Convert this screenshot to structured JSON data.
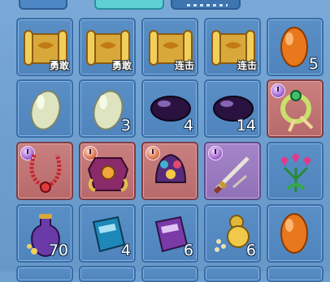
{
  "inventory": {
    "slots": [
      {
        "item": "scroll-icon",
        "tag": "勇敢",
        "count": ""
      },
      {
        "item": "scroll-icon",
        "tag": "勇敢",
        "count": ""
      },
      {
        "item": "scroll-icon",
        "tag": "连击",
        "count": ""
      },
      {
        "item": "scroll-icon",
        "tag": "连击",
        "count": ""
      },
      {
        "item": "orange-gem-icon",
        "tag": "",
        "count": "5"
      },
      {
        "item": "pale-stone-icon",
        "tag": "",
        "count": ""
      },
      {
        "item": "pale-stone-icon",
        "tag": "",
        "count": "3"
      },
      {
        "item": "dark-gem-icon",
        "tag": "",
        "count": "4"
      },
      {
        "item": "dark-gem-icon",
        "tag": "",
        "count": "14"
      },
      {
        "item": "jade-bracelet-icon",
        "tag": "",
        "count": ""
      },
      {
        "item": "red-necklace-icon",
        "tag": "",
        "count": ""
      },
      {
        "item": "armor-icon",
        "tag": "",
        "count": ""
      },
      {
        "item": "headdress-icon",
        "tag": "",
        "count": ""
      },
      {
        "item": "sword-icon",
        "tag": "",
        "count": ""
      },
      {
        "item": "flower-icon",
        "tag": "",
        "count": ""
      },
      {
        "item": "potion-bottle-icon",
        "tag": "",
        "count": "70"
      },
      {
        "item": "blue-book-icon",
        "tag": "",
        "count": "4"
      },
      {
        "item": "purple-book-icon",
        "tag": "",
        "count": "6"
      },
      {
        "item": "gourd-icon",
        "tag": "",
        "count": "6"
      },
      {
        "item": "orange-gem-icon",
        "tag": "",
        "count": ""
      }
    ]
  }
}
